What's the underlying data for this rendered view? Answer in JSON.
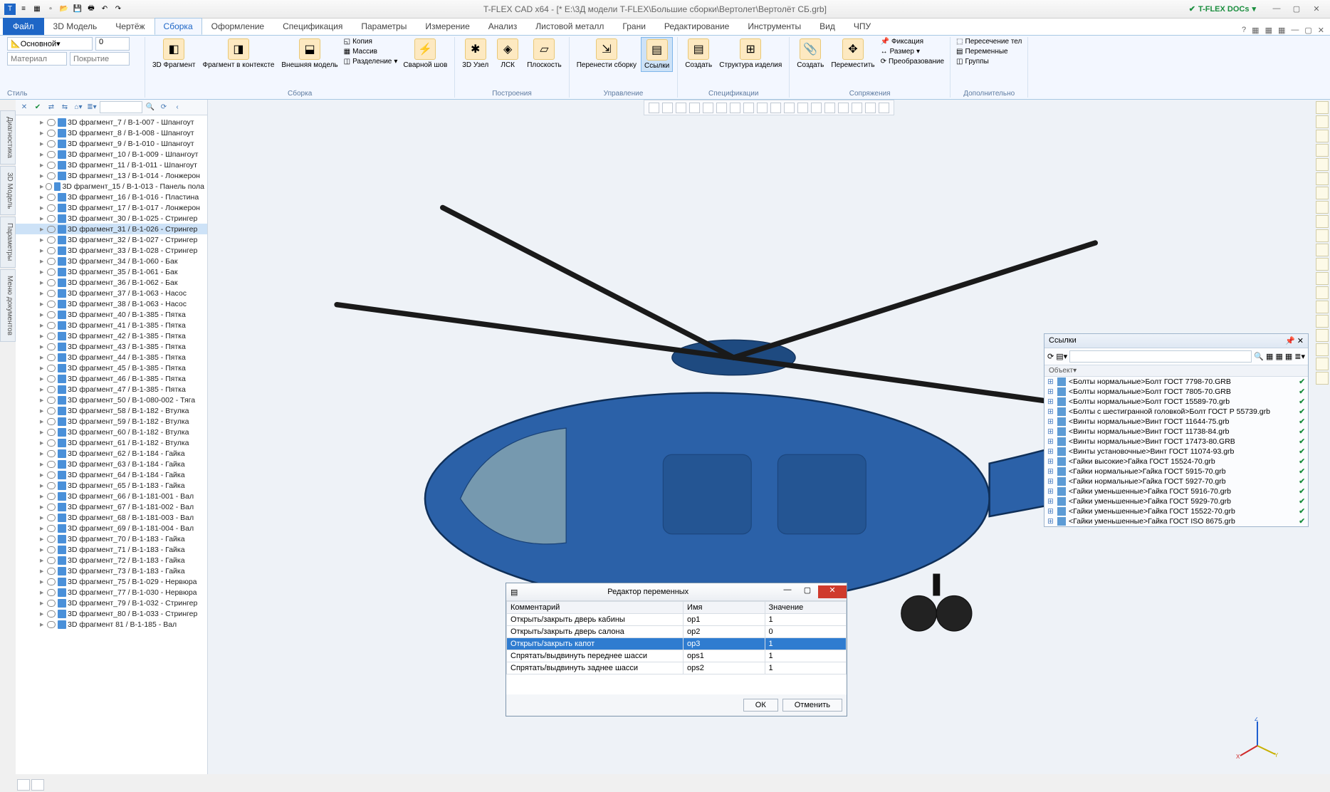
{
  "app": {
    "title": "T-FLEX CAD x64 - [* E:\\3Д модели T-FLEX\\Большие сборки\\Вертолет\\Вертолёт СБ.grb]",
    "docs_label": "T-FLEX DOCs"
  },
  "tabs": {
    "file": "Файл",
    "items": [
      "3D Модель",
      "Чертёж",
      "Сборка",
      "Оформление",
      "Спецификация",
      "Параметры",
      "Измерение",
      "Анализ",
      "Листовой металл",
      "Грани",
      "Редактирование",
      "Инструменты",
      "Вид",
      "ЧПУ"
    ],
    "active_index": 2
  },
  "ribbon": {
    "group_style": {
      "label": "Стиль",
      "main": "Основной",
      "zero": "0",
      "material": "Материал",
      "coating": "Покрытие"
    },
    "btn_3d_frag": "3D\nФрагмент",
    "btn_ctx": "Фрагмент в\nконтексте",
    "btn_ext_model": "Внешняя\nмодель",
    "small1": [
      "Копия",
      "Массив",
      "Разделение"
    ],
    "group_assembly": "Сборка",
    "btn_weld": "Сварной\nшов",
    "btn_3dnode": "3D\nУзел",
    "btn_lsk": "ЛСК",
    "btn_plane": "Плоскость",
    "group_build": "Построения",
    "btn_move_asm": "Перенести\nсборку",
    "btn_links": "Ссылки",
    "group_mgmt": "Управление",
    "btn_create": "Создать",
    "btn_struct": "Структура\nизделия",
    "group_spec": "Спецификации",
    "btn_create2": "Создать",
    "btn_move": "Переместить",
    "small2": [
      "Фиксация",
      "Размер",
      "Преобразование"
    ],
    "group_mate": "Сопряжения",
    "small3": [
      "Пересечение тел",
      "Переменные",
      "Группы"
    ],
    "group_extra": "Дополнительно"
  },
  "tree": {
    "items": [
      {
        "name": "3D фрагмент_7 / B-1-007 - Шпангоут"
      },
      {
        "name": "3D фрагмент_8 / B-1-008 - Шпангоут"
      },
      {
        "name": "3D фрагмент_9 / B-1-010 - Шпангоут"
      },
      {
        "name": "3D фрагмент_10 / B-1-009 - Шпангоут"
      },
      {
        "name": "3D фрагмент_11 / B-1-011 - Шпангоут"
      },
      {
        "name": "3D фрагмент_13 / B-1-014 - Лонжерон"
      },
      {
        "name": "3D фрагмент_15 / B-1-013 - Панель пола"
      },
      {
        "name": "3D фрагмент_16 / B-1-016 - Пластина"
      },
      {
        "name": "3D фрагмент_17 / B-1-017 - Лонжерон"
      },
      {
        "name": "3D фрагмент_30 / B-1-025 - Стрингер"
      },
      {
        "name": "3D фрагмент_31 / B-1-026 - Стрингер",
        "sel": true
      },
      {
        "name": "3D фрагмент_32 / B-1-027 - Стрингер"
      },
      {
        "name": "3D фрагмент_33 / B-1-028 - Стрингер"
      },
      {
        "name": "3D фрагмент_34 / B-1-060 - Бак"
      },
      {
        "name": "3D фрагмент_35 / B-1-061 - Бак"
      },
      {
        "name": "3D фрагмент_36 / B-1-062 - Бак"
      },
      {
        "name": "3D фрагмент_37 / B-1-063 - Насос"
      },
      {
        "name": "3D фрагмент_38 / B-1-063 - Насос"
      },
      {
        "name": "3D фрагмент_40 / B-1-385 - Пятка"
      },
      {
        "name": "3D фрагмент_41 / B-1-385 - Пятка"
      },
      {
        "name": "3D фрагмент_42 / B-1-385 - Пятка"
      },
      {
        "name": "3D фрагмент_43 / B-1-385 - Пятка"
      },
      {
        "name": "3D фрагмент_44 / B-1-385 - Пятка"
      },
      {
        "name": "3D фрагмент_45 / B-1-385 - Пятка"
      },
      {
        "name": "3D фрагмент_46 / B-1-385 - Пятка"
      },
      {
        "name": "3D фрагмент_47 / B-1-385 - Пятка"
      },
      {
        "name": "3D фрагмент_50 / B-1-080-002 - Тяга"
      },
      {
        "name": "3D фрагмент_58 / B-1-182 - Втулка"
      },
      {
        "name": "3D фрагмент_59 / B-1-182 - Втулка"
      },
      {
        "name": "3D фрагмент_60 / B-1-182 - Втулка"
      },
      {
        "name": "3D фрагмент_61 / B-1-182 - Втулка"
      },
      {
        "name": "3D фрагмент_62 / B-1-184 - Гайка"
      },
      {
        "name": "3D фрагмент_63 / B-1-184 - Гайка"
      },
      {
        "name": "3D фрагмент_64 / B-1-184 - Гайка"
      },
      {
        "name": "3D фрагмент_65 / B-1-183 - Гайка"
      },
      {
        "name": "3D фрагмент_66 / B-1-181-001 - Вал"
      },
      {
        "name": "3D фрагмент_67 / B-1-181-002 - Вал"
      },
      {
        "name": "3D фрагмент_68 / B-1-181-003 - Вал"
      },
      {
        "name": "3D фрагмент_69 / B-1-181-004 - Вал"
      },
      {
        "name": "3D фрагмент_70 / B-1-183 - Гайка"
      },
      {
        "name": "3D фрагмент_71 / B-1-183 - Гайка"
      },
      {
        "name": "3D фрагмент_72 / B-1-183 - Гайка"
      },
      {
        "name": "3D фрагмент_73 / B-1-183 - Гайка"
      },
      {
        "name": "3D фрагмент_75 / B-1-029 - Нервюра"
      },
      {
        "name": "3D фрагмент_77 / B-1-030 - Нервюра"
      },
      {
        "name": "3D фрагмент_79 / B-1-032 - Стрингер"
      },
      {
        "name": "3D фрагмент_80 / B-1-033 - Стрингер"
      },
      {
        "name": "3D фрагмент 81 / B-1-185 - Вал"
      }
    ]
  },
  "left_tabs": [
    "Диагностика",
    "3D Модель",
    "Параметры",
    "Меню документов"
  ],
  "links_panel": {
    "title": "Ссылки",
    "col_obj": "Объект",
    "rows": [
      "<Болты нормальные>Болт ГОСТ 7798-70.GRB",
      "<Болты нормальные>Болт ГОСТ 7805-70.GRB",
      "<Болты нормальные>Болт ГОСТ 15589-70.grb",
      "<Болты с шестигранной головкой>Болт ГОСТ Р 55739.grb",
      "<Винты нормальные>Винт ГОСТ 11644-75.grb",
      "<Винты нормальные>Винт ГОСТ 11738-84.grb",
      "<Винты нормальные>Винт ГОСТ 17473-80.GRB",
      "<Винты установочные>Винт ГОСТ 11074-93.grb",
      "<Гайки высокие>Гайка ГОСТ 15524-70.grb",
      "<Гайки нормальные>Гайка ГОСТ 5915-70.grb",
      "<Гайки нормальные>Гайка ГОСТ 5927-70.grb",
      "<Гайки уменьшенные>Гайка ГОСТ 5916-70.grb",
      "<Гайки уменьшенные>Гайка ГОСТ 5929-70.grb",
      "<Гайки уменьшенные>Гайка ГОСТ 15522-70.grb",
      "<Гайки уменьшенные>Гайка ГОСТ ISO 8675.grb"
    ]
  },
  "vardlg": {
    "title": "Редактор переменных",
    "cols": [
      "Комментарий",
      "Имя",
      "Значение"
    ],
    "rows": [
      {
        "c": "Открыть/закрыть дверь кабины",
        "n": "op1",
        "v": "1"
      },
      {
        "c": "Открыть/закрыть дверь салона",
        "n": "op2",
        "v": "0"
      },
      {
        "c": "Открыть/закрыть капот",
        "n": "op3",
        "v": "1",
        "sel": true
      },
      {
        "c": "Спрятать/выдвинуть переднее шасси",
        "n": "ops1",
        "v": "1"
      },
      {
        "c": "Спрятать/выдвинуть заднее шасси",
        "n": "ops2",
        "v": "1"
      }
    ],
    "ok": "ОК",
    "cancel": "Отменить"
  }
}
